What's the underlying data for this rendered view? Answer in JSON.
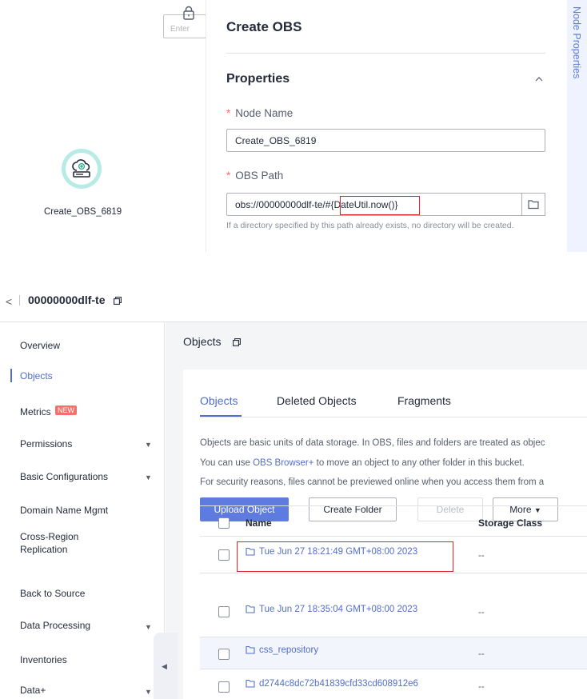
{
  "top": {
    "canvas_input_placeholder": "Enter",
    "node": {
      "label": "Create_OBS_6819",
      "icon": "cloud-upload-icon"
    },
    "panel": {
      "title": "Create OBS",
      "section": "Properties",
      "fields": [
        {
          "label": "Node Name",
          "required": true,
          "value": "Create_OBS_6819"
        },
        {
          "label": "OBS Path",
          "required": true,
          "value_prefix": "obs://00000000dlf-te/#",
          "value_highlight": "{DateUtil.now()}"
        }
      ],
      "hint": "If a directory specified by this path already exists, no directory will be created."
    },
    "side_tab": "Node Properties"
  },
  "bucket": {
    "back": "<",
    "name": "00000000dlf-te"
  },
  "sidebar": {
    "items": [
      {
        "label": "Overview"
      },
      {
        "label": "Objects",
        "active": true
      },
      {
        "label": "Metrics",
        "badge": "NEW"
      },
      {
        "label": "Permissions",
        "expandable": true
      },
      {
        "label": "Basic Configurations",
        "expandable": true
      },
      {
        "label": "Domain Name Mgmt"
      },
      {
        "label": "Cross-Region",
        "label2": "Replication"
      },
      {
        "label": "Back to Source"
      },
      {
        "label": "Data Processing",
        "expandable": true
      },
      {
        "label": "Inventories"
      },
      {
        "label": "Data+",
        "expandable": true
      }
    ]
  },
  "main": {
    "heading": "Objects",
    "tabs": [
      "Objects",
      "Deleted Objects",
      "Fragments"
    ],
    "desc1": "Objects are basic units of data storage. In OBS, files and folders are treated as objec",
    "desc2_pre": "You can use ",
    "desc2_link": "OBS Browser+",
    "desc2_post": " to move an object to any other folder in this bucket.",
    "desc3": "For security reasons, files cannot be previewed online when you access them from a",
    "buttons": {
      "upload": "Upload Object",
      "create_folder": "Create Folder",
      "delete": "Delete",
      "more": "More"
    },
    "columns": {
      "name": "Name",
      "storage": "Storage Class"
    },
    "rows": [
      {
        "name": "Tue Jun 27 18:21:49 GMT+08:00 2023",
        "storage": "--"
      },
      {
        "name": "Tue Jun 27 18:35:04 GMT+08:00 2023",
        "storage": "--"
      },
      {
        "name": "css_repository",
        "storage": "--"
      },
      {
        "name": "d2744c8dc72b41839cfd33cd608912e6",
        "storage": "--"
      }
    ]
  },
  "colors": {
    "accent": "#526ecc",
    "primary_button": "#5e7ce0",
    "highlight_box": "#d8252a",
    "node_ring": "#b8ebe5"
  }
}
